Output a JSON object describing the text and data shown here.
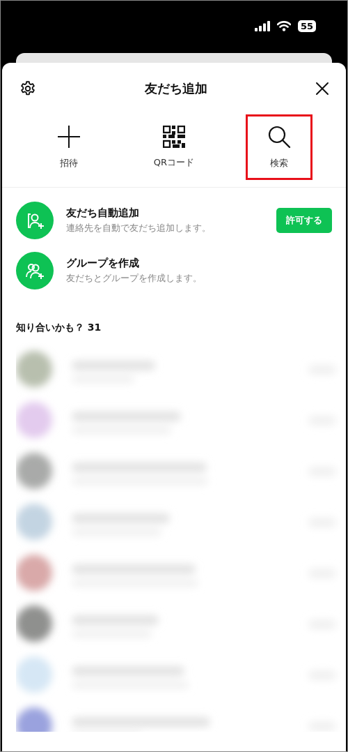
{
  "status_bar": {
    "battery": "55"
  },
  "header": {
    "title": "友だち追加"
  },
  "actions": [
    {
      "kind": "invite",
      "label": "招待",
      "highlighted": false
    },
    {
      "kind": "qr",
      "label": "QRコード",
      "highlighted": false
    },
    {
      "kind": "search",
      "label": "検索",
      "highlighted": true
    }
  ],
  "options": [
    {
      "kind": "auto",
      "title": "友だち自動追加",
      "subtitle": "連絡先を自動で友だち追加します。",
      "button": "許可する"
    },
    {
      "kind": "group",
      "title": "グループを作成",
      "subtitle": "友だちとグループを作成します。"
    }
  ],
  "suggestions": {
    "title": "知り合いかも？ 31"
  }
}
